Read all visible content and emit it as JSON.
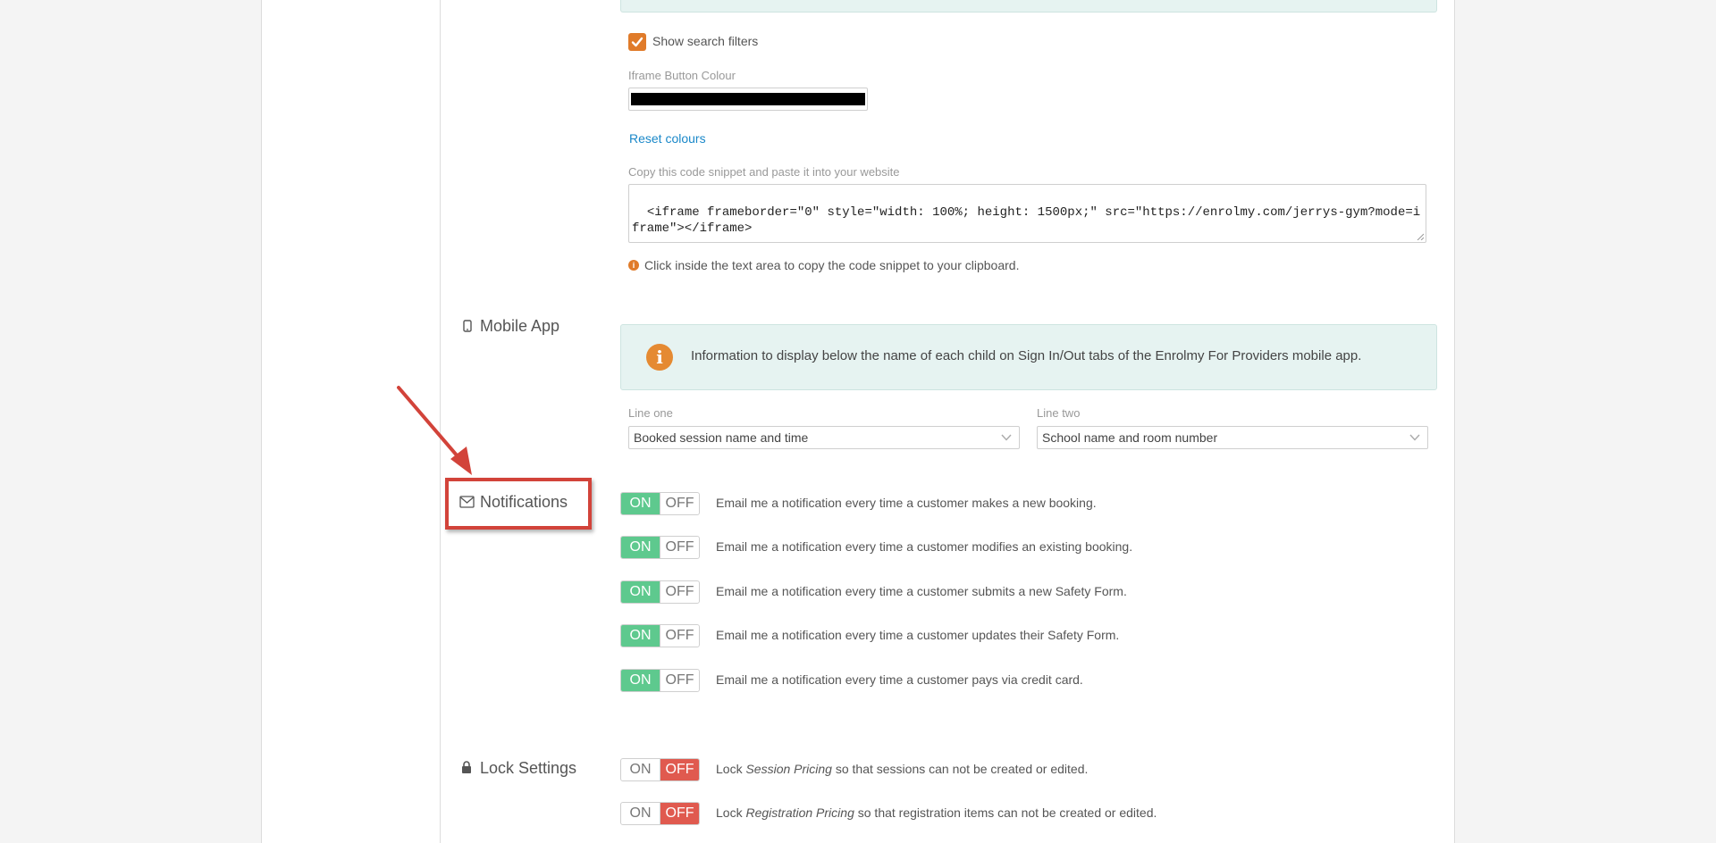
{
  "embed": {
    "show_filters_label": "Show search filters",
    "show_filters_checked": true,
    "iframe_color_label": "Iframe Button Colour",
    "iframe_color_value": "#000000",
    "reset_link": "Reset colours",
    "snippet_label": "Copy this code snippet and paste it into your website",
    "snippet_code": "<iframe frameborder=\"0\" style=\"width: 100%; height: 1500px;\" src=\"https://enrolmy.com/jerrys-gym?mode=iframe\"></iframe>",
    "snippet_hint": "Click inside the text area to copy the code snippet to your clipboard."
  },
  "mobile_app": {
    "title": "Mobile App",
    "info_text": "Information to display below the name of each child on Sign In/Out tabs of the Enrolmy For Providers mobile app.",
    "line_one_label": "Line one",
    "line_one_value": "Booked session name and time",
    "line_two_label": "Line two",
    "line_two_value": "School name and room number"
  },
  "notifications": {
    "title": "Notifications",
    "on_label": "ON",
    "off_label": "OFF",
    "items": [
      {
        "text": "Email me a notification every time a customer makes a new booking.",
        "state": "on"
      },
      {
        "text": "Email me a notification every time a customer modifies an existing booking.",
        "state": "on"
      },
      {
        "text": "Email me a notification every time a customer submits a new Safety Form.",
        "state": "on"
      },
      {
        "text": "Email me a notification every time a customer updates their Safety Form.",
        "state": "on"
      },
      {
        "text": "Email me a notification every time a customer pays via credit card.",
        "state": "on"
      }
    ]
  },
  "lock_settings": {
    "title": "Lock Settings",
    "items": [
      {
        "prefix": "Lock ",
        "emphasis": "Session Pricing",
        "suffix": " so that sessions can not be created or edited.",
        "state": "off"
      },
      {
        "prefix": "Lock ",
        "emphasis": "Registration Pricing",
        "suffix": " so that registration items can not be created or edited.",
        "state": "off"
      }
    ]
  },
  "colors": {
    "accent_orange": "#e07b2a",
    "link_blue": "#1a88c9",
    "toggle_on": "#5ec98e",
    "toggle_off": "#e05a4f",
    "annotation_red": "#d2433a"
  }
}
